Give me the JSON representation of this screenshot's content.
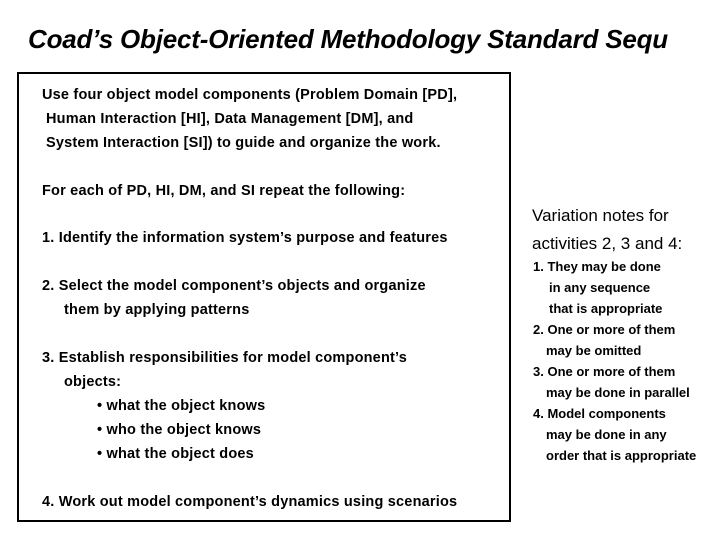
{
  "title": "Coad’s Object-Oriented Methodology Standard Sequ",
  "main": {
    "intro_lines": [
      "Use four object model components (Problem Domain [PD],",
      "Human Interaction [HI], Data Management [DM], and",
      "System Interaction [SI]) to guide and organize the work."
    ],
    "repeat_heading": "For each of PD, HI, DM, and SI repeat the following:",
    "steps": [
      {
        "lines": [
          "1.  Identify the information system’s purpose and features"
        ]
      },
      {
        "lines": [
          "2.  Select the model component’s objects and organize",
          "them by applying patterns"
        ]
      },
      {
        "lines": [
          "3.  Establish responsibilities for model component’s",
          "objects:"
        ],
        "bullets": [
          "• what the object knows",
          "• who the object knows",
          "• what the object does"
        ]
      },
      {
        "lines": [
          "4.  Work out model component’s dynamics using scenarios"
        ]
      }
    ]
  },
  "notes": {
    "heading_lines": [
      "Variation notes for",
      "activities 2, 3 and 4:"
    ],
    "items": [
      "1. They may be done",
      "in any sequence",
      "that is appropriate",
      "2. One or more of them",
      "may be omitted",
      "3. One or more of them",
      "may be done in parallel",
      "4. Model components",
      "may be done in any",
      "order that is appropriate"
    ]
  }
}
